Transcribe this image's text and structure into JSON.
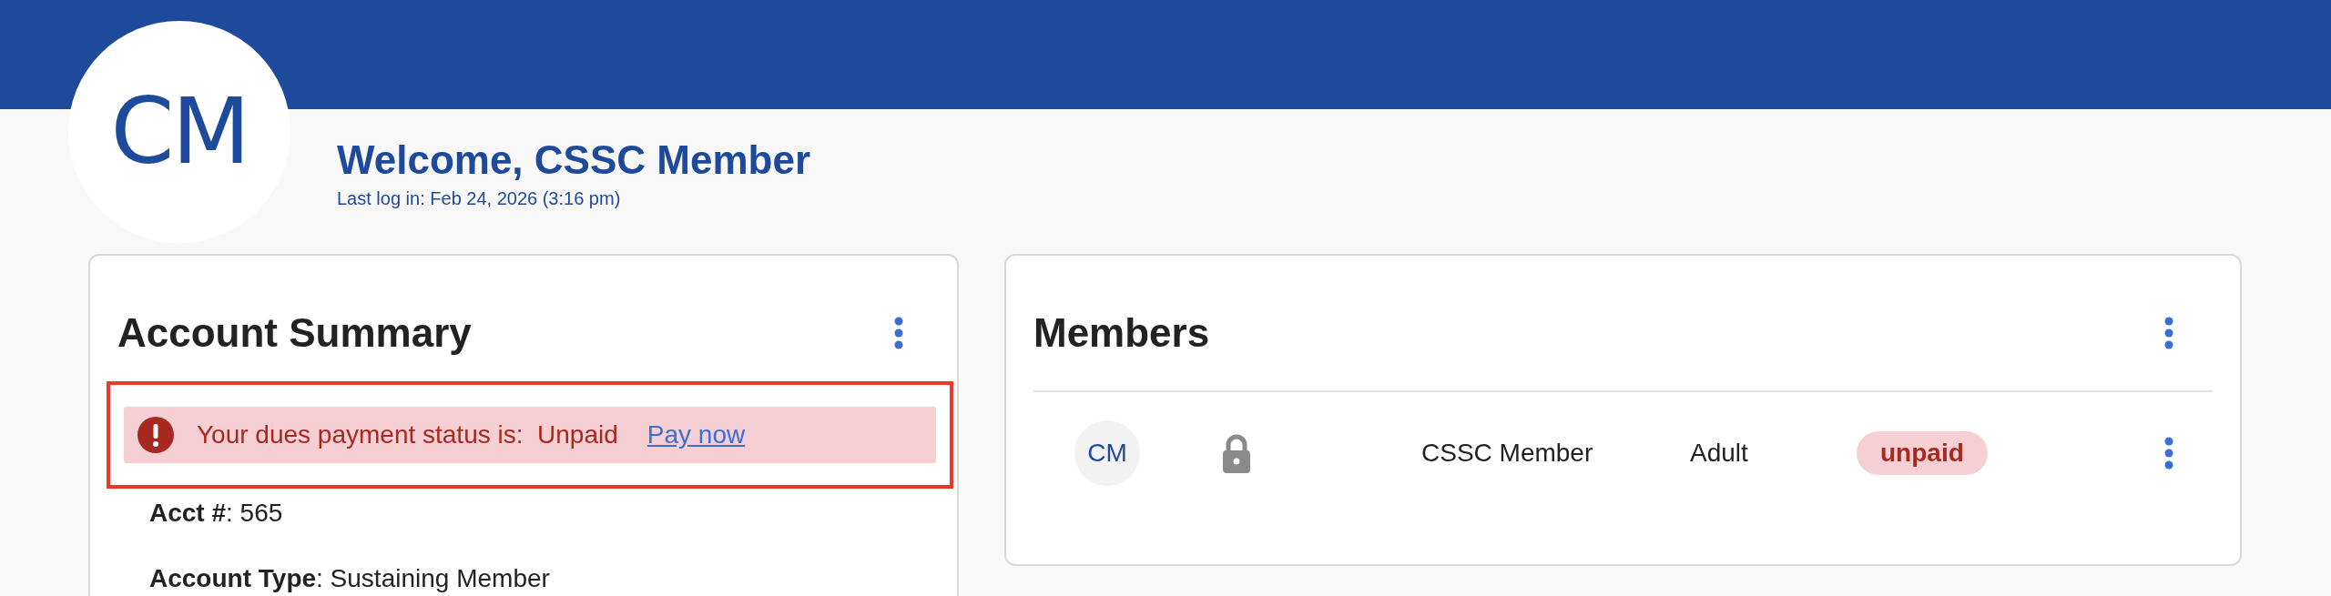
{
  "header": {
    "avatar_initials": "CM",
    "welcome": "Welcome, CSSC Member",
    "last_login": "Last log in: Feb 24, 2026 (3:16 pm)"
  },
  "account_summary": {
    "title": "Account Summary",
    "alert": {
      "highlighted": true,
      "message": "Your dues payment status is:  Unpaid",
      "link": "Pay now"
    },
    "fields": [
      {
        "text": "**Acct #**: 565"
      },
      {
        "text": "**Account Type**: Sustaining Member"
      }
    ]
  },
  "members": {
    "title": "Members",
    "rows": [
      {
        "initials": "CM",
        "locked": true,
        "name": "CSSC Member",
        "type": "Adult",
        "status": "unpaid"
      }
    ]
  }
}
